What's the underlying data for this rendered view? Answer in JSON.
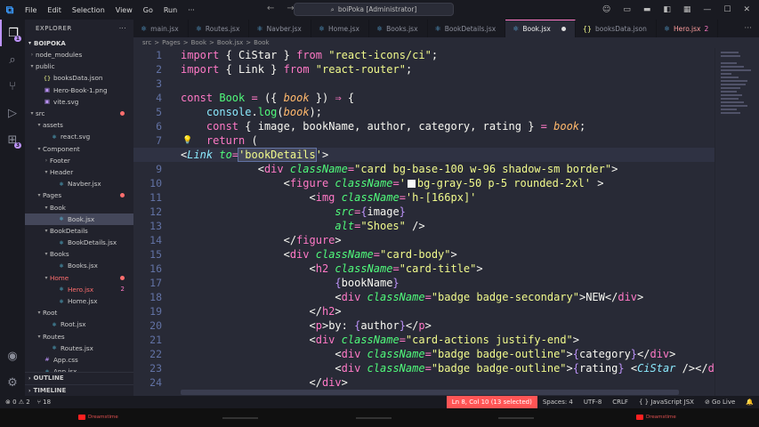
{
  "titlebar": {
    "menu": [
      "File",
      "Edit",
      "Selection",
      "View",
      "Go",
      "Run",
      "···"
    ],
    "search": "boiPoka [Administrator]"
  },
  "explorer": {
    "header": "EXPLORER",
    "project": "BOIPOKA",
    "tree": [
      {
        "label": "node_modules",
        "depth": 1,
        "type": "folder",
        "open": false
      },
      {
        "label": "public",
        "depth": 1,
        "type": "folder",
        "open": true
      },
      {
        "label": "booksData.json",
        "depth": 2,
        "type": "json"
      },
      {
        "label": "Hero-Book-1.png",
        "depth": 2,
        "type": "image"
      },
      {
        "label": "vite.svg",
        "depth": 2,
        "type": "image"
      },
      {
        "label": "src",
        "depth": 1,
        "type": "folder",
        "open": true,
        "dot": true
      },
      {
        "label": "assets",
        "depth": 2,
        "type": "folder",
        "open": true
      },
      {
        "label": "react.svg",
        "depth": 3,
        "type": "react"
      },
      {
        "label": "Component",
        "depth": 2,
        "type": "folder",
        "open": true
      },
      {
        "label": "Footer",
        "depth": 3,
        "type": "folder",
        "open": false
      },
      {
        "label": "Header",
        "depth": 3,
        "type": "folder",
        "open": true
      },
      {
        "label": "Navber.jsx",
        "depth": 4,
        "type": "react"
      },
      {
        "label": "Pages",
        "depth": 2,
        "type": "folder",
        "open": true,
        "dot": true
      },
      {
        "label": "Book",
        "depth": 3,
        "type": "folder",
        "open": true
      },
      {
        "label": "Book.jsx",
        "depth": 4,
        "type": "react",
        "selected": true
      },
      {
        "label": "BookDetails",
        "depth": 3,
        "type": "folder",
        "open": true
      },
      {
        "label": "BookDetails.jsx",
        "depth": 4,
        "type": "react"
      },
      {
        "label": "Books",
        "depth": 3,
        "type": "folder",
        "open": true
      },
      {
        "label": "Books.jsx",
        "depth": 4,
        "type": "react"
      },
      {
        "label": "Home",
        "depth": 3,
        "type": "folder",
        "open": true,
        "err": true,
        "dot": true
      },
      {
        "label": "Hero.jsx",
        "depth": 4,
        "type": "react",
        "err": true,
        "count": "2"
      },
      {
        "label": "Home.jsx",
        "depth": 4,
        "type": "react"
      },
      {
        "label": "Root",
        "depth": 2,
        "type": "folder",
        "open": true
      },
      {
        "label": "Root.jsx",
        "depth": 3,
        "type": "react"
      },
      {
        "label": "Routes",
        "depth": 2,
        "type": "folder",
        "open": true
      },
      {
        "label": "Routes.jsx",
        "depth": 3,
        "type": "react"
      },
      {
        "label": "App.css",
        "depth": 2,
        "type": "css"
      },
      {
        "label": "App.jsx",
        "depth": 2,
        "type": "react"
      }
    ],
    "outline": "OUTLINE",
    "timeline": "TIMELINE"
  },
  "tabs": [
    {
      "label": "main.jsx"
    },
    {
      "label": "Routes.jsx"
    },
    {
      "label": "Navber.jsx"
    },
    {
      "label": "Home.jsx"
    },
    {
      "label": "Books.jsx"
    },
    {
      "label": "BookDetails.jsx"
    },
    {
      "label": "Book.jsx",
      "active": true,
      "modified": true
    },
    {
      "label": "booksData.json"
    },
    {
      "label": "Hero.jsx",
      "count": "2",
      "err": true
    }
  ],
  "breadcrumb": [
    "src",
    ">",
    "Pages",
    ">",
    "Book",
    ">",
    "Book.jsx",
    ">",
    "Book"
  ],
  "editor": {
    "line_numbers": [
      "1",
      "2",
      "3",
      "4",
      "5",
      "6",
      "7",
      "8",
      "9",
      "10",
      "11",
      "12",
      "13",
      "14",
      "15",
      "16",
      "17",
      "18",
      "19",
      "20",
      "21",
      "22",
      "23",
      "24"
    ],
    "current_line": "8"
  },
  "statusbar": {
    "left": [
      "⊗ 0  ⚠ 2",
      "⑂ 18"
    ],
    "right": [
      "Ln 8, Col 10 (13 selected)",
      "Spaces: 4",
      "UTF-8",
      "CRLF",
      "{ } JavaScript JSX",
      "⊘ Go Live",
      "🔔"
    ]
  },
  "taskbar": {
    "watermark": "Dreamstime"
  }
}
